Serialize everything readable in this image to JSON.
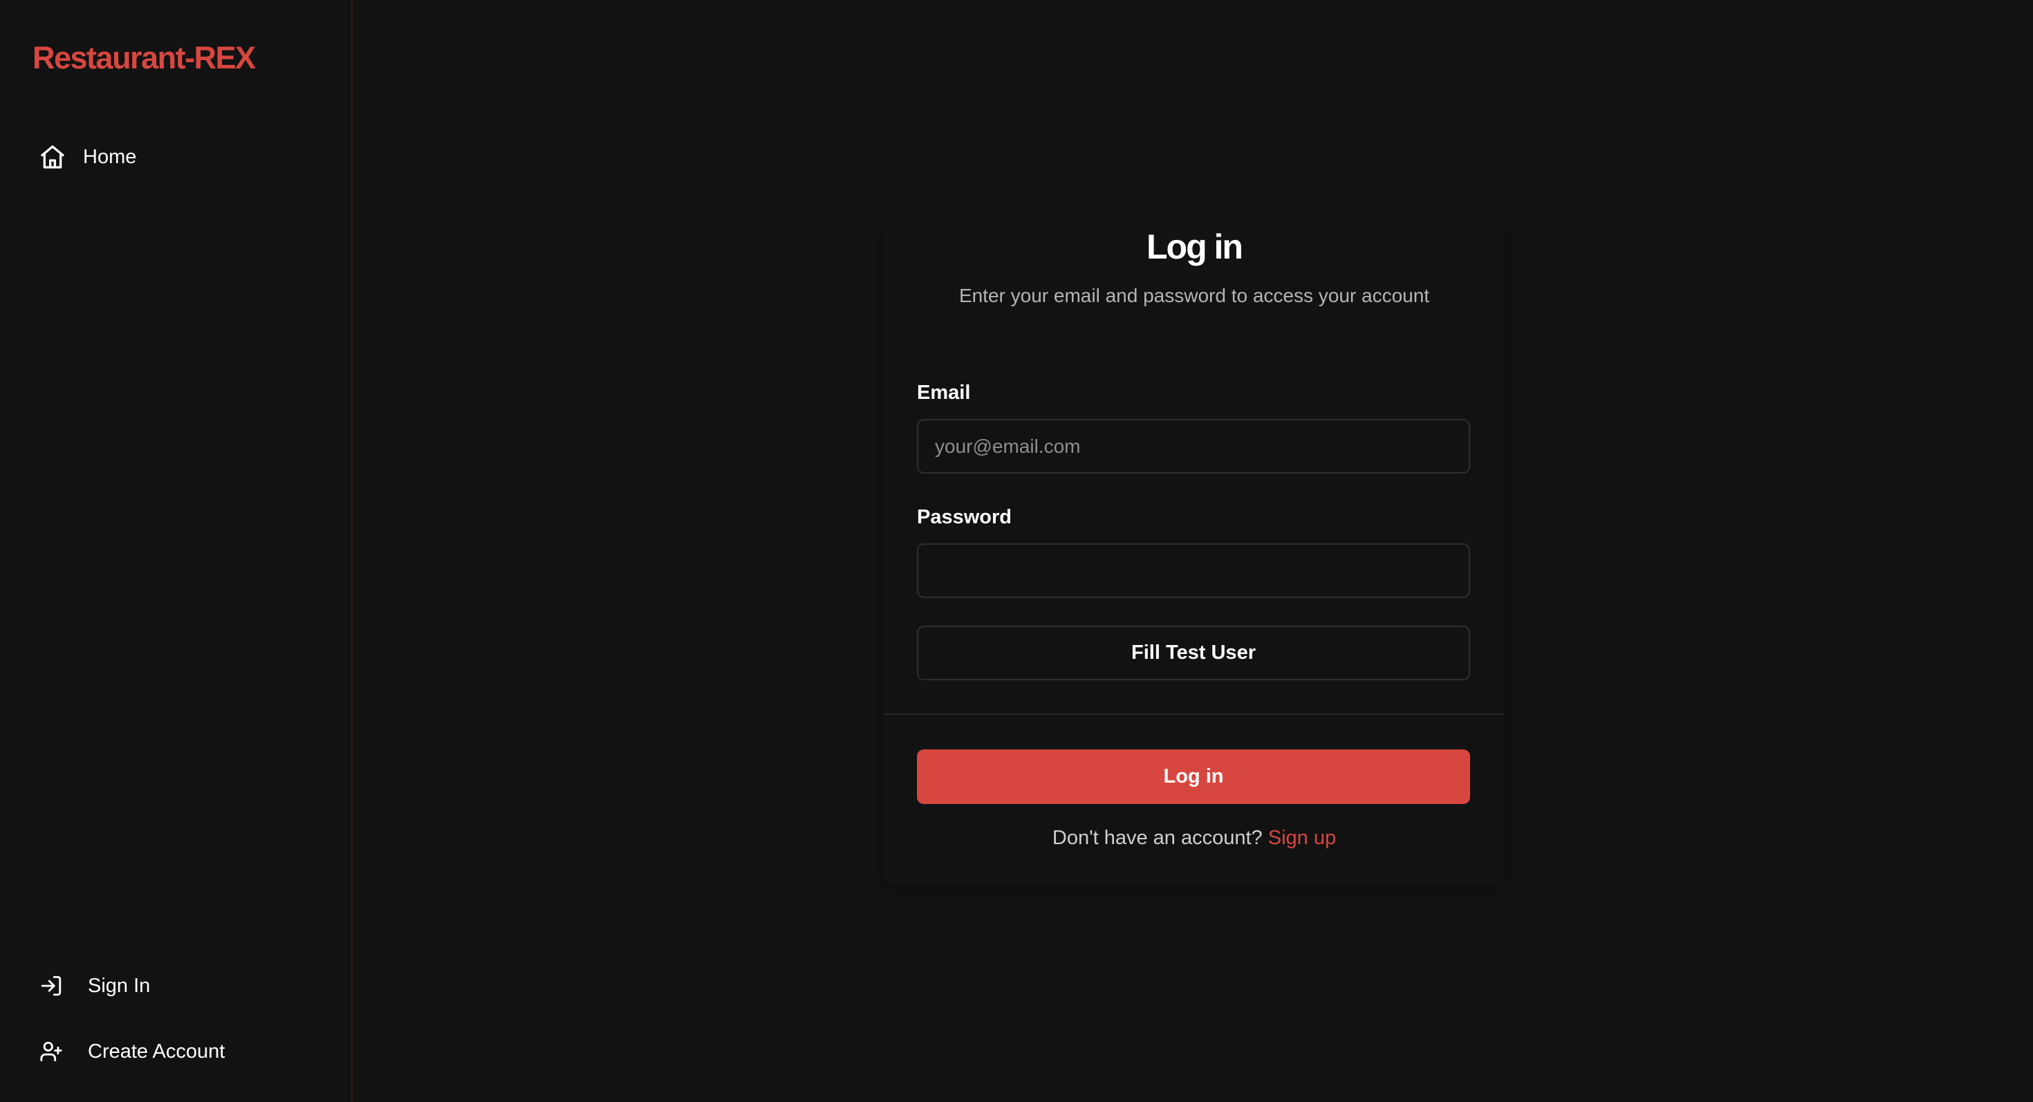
{
  "brand": {
    "name": "Restaurant-REX",
    "color": "#d7473f"
  },
  "sidebar": {
    "top_items": [
      {
        "label": "Home",
        "icon": "home-icon"
      }
    ],
    "bottom_items": [
      {
        "label": "Sign In",
        "icon": "log-in-icon"
      },
      {
        "label": "Create Account",
        "icon": "user-plus-icon"
      }
    ]
  },
  "login": {
    "title": "Log in",
    "subtitle": "Enter your email and password to access your account",
    "email": {
      "label": "Email",
      "placeholder": "your@email.com",
      "value": ""
    },
    "password": {
      "label": "Password",
      "placeholder": "",
      "value": ""
    },
    "fill_test_user_label": "Fill Test User",
    "submit_label": "Log in",
    "signup_prompt": "Don't have an account?",
    "signup_link": "Sign up"
  },
  "colors": {
    "background": "#121212",
    "accent": "#d7473f",
    "border": "#2e2e2e"
  }
}
